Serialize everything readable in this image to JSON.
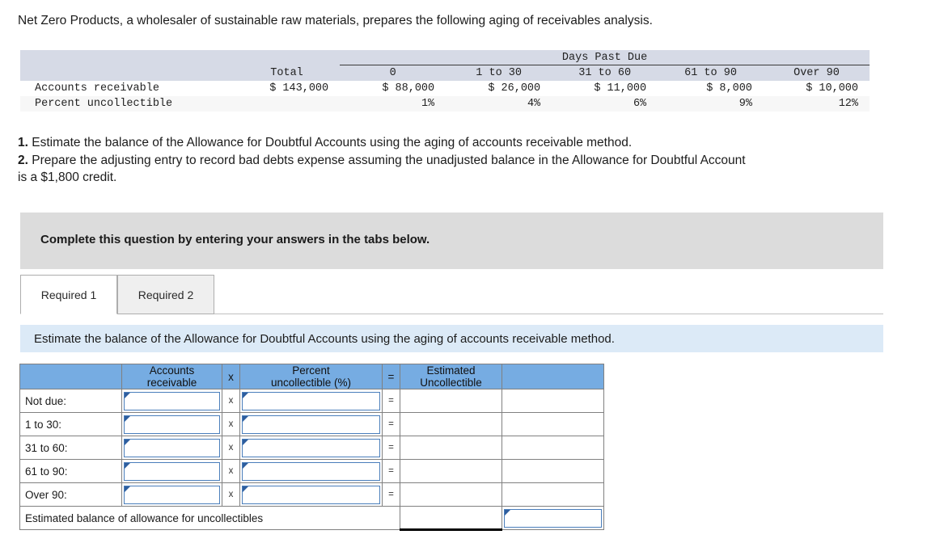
{
  "intro": "Net Zero Products, a wholesaler of sustainable raw materials, prepares the following aging of receivables analysis.",
  "aging_table": {
    "group_header": "Days Past Due",
    "columns": [
      "Total",
      "0",
      "1 to 30",
      "31 to 60",
      "61 to 90",
      "Over 90"
    ],
    "rows": [
      {
        "label": "Accounts receivable",
        "values": [
          "$ 143,000",
          "$ 88,000",
          "$ 26,000",
          "$ 11,000",
          "$ 8,000",
          "$ 10,000"
        ]
      },
      {
        "label": "Percent uncollectible",
        "values": [
          "",
          "1%",
          "4%",
          "6%",
          "9%",
          "12%"
        ]
      }
    ]
  },
  "requirements": {
    "num1": "1.",
    "text1": "Estimate the balance of the Allowance for Doubtful Accounts using the aging of accounts receivable method.",
    "num2": "2.",
    "text2": "Prepare the adjusting entry to record bad debts expense assuming the unadjusted balance in the Allowance for Doubtful Account",
    "text2b": "is a $1,800 credit."
  },
  "banner": {
    "text": "Complete this question by entering your answers in the tabs below."
  },
  "tabs": [
    {
      "label": "Required 1",
      "active": true
    },
    {
      "label": "Required 2",
      "active": false
    }
  ],
  "blue_bar": {
    "text": "Estimate the balance of the Allowance for Doubtful Accounts using the aging of accounts receivable method."
  },
  "answer_grid": {
    "headers": {
      "label": "",
      "accounts_receivable": "Accounts receivable",
      "ar_line1": "Accounts",
      "ar_line2": "receivable",
      "multiply": "x",
      "percent_line1": "Percent",
      "percent_line2": "uncollectible (%)",
      "equals": "=",
      "estimated_line1": "Estimated",
      "estimated_line2": "Uncollectible",
      "total": ""
    },
    "operators": {
      "multiply": "x",
      "equals": "="
    },
    "rows": [
      {
        "label": "Not due:",
        "accounts_receivable": "",
        "percent_uncollectible": "",
        "estimated_uncollectible": "",
        "total": ""
      },
      {
        "label": "1 to 30:",
        "accounts_receivable": "",
        "percent_uncollectible": "",
        "estimated_uncollectible": "",
        "total": ""
      },
      {
        "label": "31 to 60:",
        "accounts_receivable": "",
        "percent_uncollectible": "",
        "estimated_uncollectible": "",
        "total": ""
      },
      {
        "label": "61 to 90:",
        "accounts_receivable": "",
        "percent_uncollectible": "",
        "estimated_uncollectible": "",
        "total": ""
      },
      {
        "label": "Over 90:",
        "accounts_receivable": "",
        "percent_uncollectible": "",
        "estimated_uncollectible": "",
        "total": ""
      }
    ],
    "summary": {
      "label": "Estimated balance of allowance for uncollectibles",
      "value": ""
    }
  },
  "colors": {
    "header_blue": "#76ACE2",
    "bar_blue": "#DCEAF7",
    "banner_gray": "#DCDCDC",
    "table_header_gray": "#D6DAE6",
    "field_border": "#4A7EBB",
    "field_flag": "#2E5E9E"
  }
}
